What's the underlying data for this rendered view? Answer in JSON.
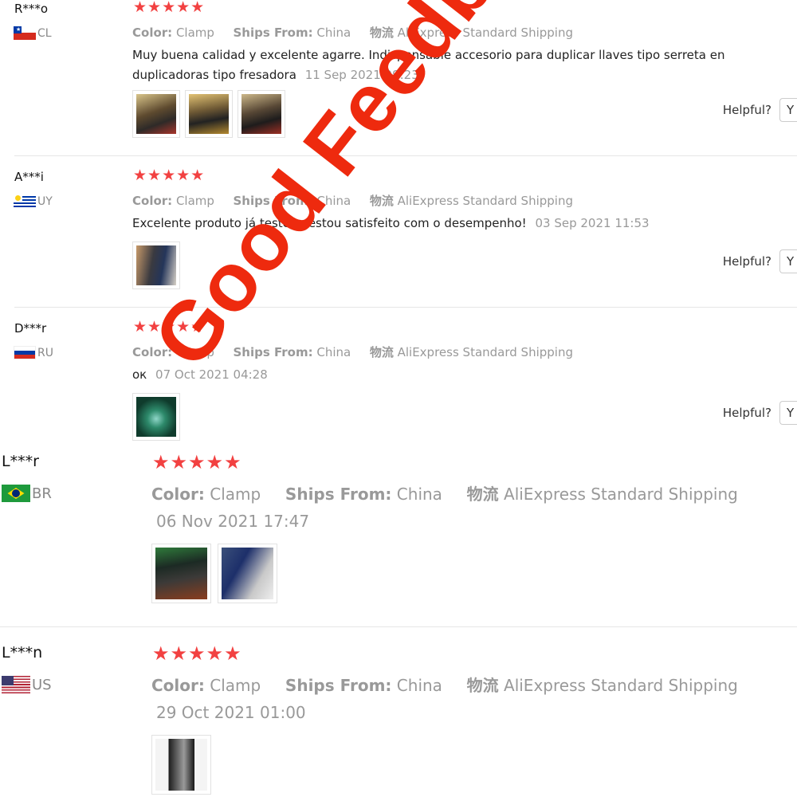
{
  "labels": {
    "color_key": "Color:",
    "ships_key": "Ships From:",
    "logistics_key": "物流",
    "helpful": "Helpful?",
    "helpful_btn": "Y"
  },
  "stars": "★★★★★",
  "reviews": [
    {
      "user": "R***o",
      "country": "CL",
      "color": "Clamp",
      "ships_from": "China",
      "shipping": "AliExpress Standard Shipping",
      "text": "Muy buena calidad y excelente agarre. Indispensable accesorio para duplicar llaves tipo serreta en duplicadoras tipo fresadora",
      "date": "11 Sep 2021 09:23",
      "photos": 3
    },
    {
      "user": "A***i",
      "country": "UY",
      "color": "Clamp",
      "ships_from": "China",
      "shipping": "AliExpress Standard Shipping",
      "text": "Excelente produto já testei e estou satisfeito com o desempenho!",
      "date": "03 Sep 2021 11:53",
      "photos": 1
    },
    {
      "user": "D***r",
      "country": "RU",
      "color": "Clamp",
      "ships_from": "China",
      "shipping": "AliExpress Standard Shipping",
      "text": "ок",
      "date": "07 Oct 2021 04:28",
      "photos": 1
    },
    {
      "user": "L***r",
      "country": "BR",
      "color": "Clamp",
      "ships_from": "China",
      "shipping": "AliExpress Standard Shipping",
      "text": "",
      "date": "06 Nov 2021 17:47",
      "photos": 2
    },
    {
      "user": "L***n",
      "country": "US",
      "color": "Clamp",
      "ships_from": "China",
      "shipping": "AliExpress Standard Shipping",
      "text": "",
      "date": "29 Oct 2021 01:00",
      "photos": 1
    }
  ],
  "watermark": "Good Feedback",
  "colors": {
    "star": "#f24141",
    "watermark": "#ee2a0e"
  }
}
